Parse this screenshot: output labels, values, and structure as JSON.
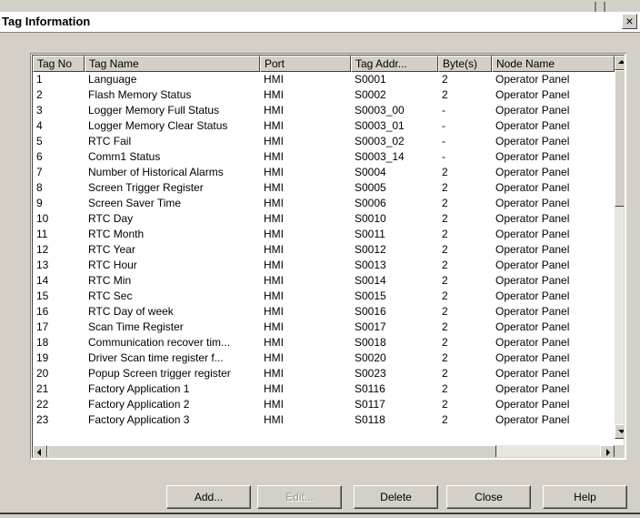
{
  "dialog": {
    "title": "Tag Information",
    "close_glyph": "×"
  },
  "columns": [
    "Tag No",
    "Tag Name",
    "Port",
    "Tag Addr...",
    "Byte(s)",
    "Node Name"
  ],
  "rows": [
    [
      "1",
      "Language",
      "HMI",
      "S0001",
      "2",
      "Operator Panel"
    ],
    [
      "2",
      "Flash Memory Status",
      "HMI",
      "S0002",
      "2",
      "Operator Panel"
    ],
    [
      "3",
      "Logger Memory Full Status",
      "HMI",
      "S0003_00",
      "-",
      "Operator Panel"
    ],
    [
      "4",
      "Logger Memory Clear Status",
      "HMI",
      "S0003_01",
      "-",
      "Operator Panel"
    ],
    [
      "5",
      "RTC Fail",
      "HMI",
      "S0003_02",
      "-",
      "Operator Panel"
    ],
    [
      "6",
      "Comm1 Status",
      "HMI",
      "S0003_14",
      "-",
      "Operator Panel"
    ],
    [
      "7",
      "Number of Historical Alarms",
      "HMI",
      "S0004",
      "2",
      "Operator Panel"
    ],
    [
      "8",
      "Screen Trigger Register",
      "HMI",
      "S0005",
      "2",
      "Operator Panel"
    ],
    [
      "9",
      "Screen Saver Time",
      "HMI",
      "S0006",
      "2",
      "Operator Panel"
    ],
    [
      "10",
      "RTC Day",
      "HMI",
      "S0010",
      "2",
      "Operator Panel"
    ],
    [
      "11",
      "RTC Month",
      "HMI",
      "S0011",
      "2",
      "Operator Panel"
    ],
    [
      "12",
      "RTC Year",
      "HMI",
      "S0012",
      "2",
      "Operator Panel"
    ],
    [
      "13",
      "RTC Hour",
      "HMI",
      "S0013",
      "2",
      "Operator Panel"
    ],
    [
      "14",
      "RTC Min",
      "HMI",
      "S0014",
      "2",
      "Operator Panel"
    ],
    [
      "15",
      "RTC Sec",
      "HMI",
      "S0015",
      "2",
      "Operator Panel"
    ],
    [
      "16",
      "RTC Day of week",
      "HMI",
      "S0016",
      "2",
      "Operator Panel"
    ],
    [
      "17",
      "Scan Time Register",
      "HMI",
      "S0017",
      "2",
      "Operator Panel"
    ],
    [
      "18",
      "Communication recover tim...",
      "HMI",
      "S0018",
      "2",
      "Operator Panel"
    ],
    [
      "19",
      "Driver Scan  time register f...",
      "HMI",
      "S0020",
      "2",
      "Operator Panel"
    ],
    [
      "20",
      "Popup Screen trigger register",
      "HMI",
      "S0023",
      "2",
      "Operator Panel"
    ],
    [
      "21",
      "Factory Application 1",
      "HMI",
      "S0116",
      "2",
      "Operator Panel"
    ],
    [
      "22",
      "Factory Application 2",
      "HMI",
      "S0117",
      "2",
      "Operator Panel"
    ],
    [
      "23",
      "Factory Application 3",
      "HMI",
      "S0118",
      "2",
      "Operator Panel"
    ]
  ],
  "buttons": {
    "add": "Add...",
    "edit": "Edit...",
    "delete": "Delete",
    "close": "Close",
    "help": "Help"
  },
  "scroll_icons": [
    "up-arrow-icon",
    "down-arrow-icon",
    "left-arrow-icon",
    "right-arrow-icon"
  ]
}
